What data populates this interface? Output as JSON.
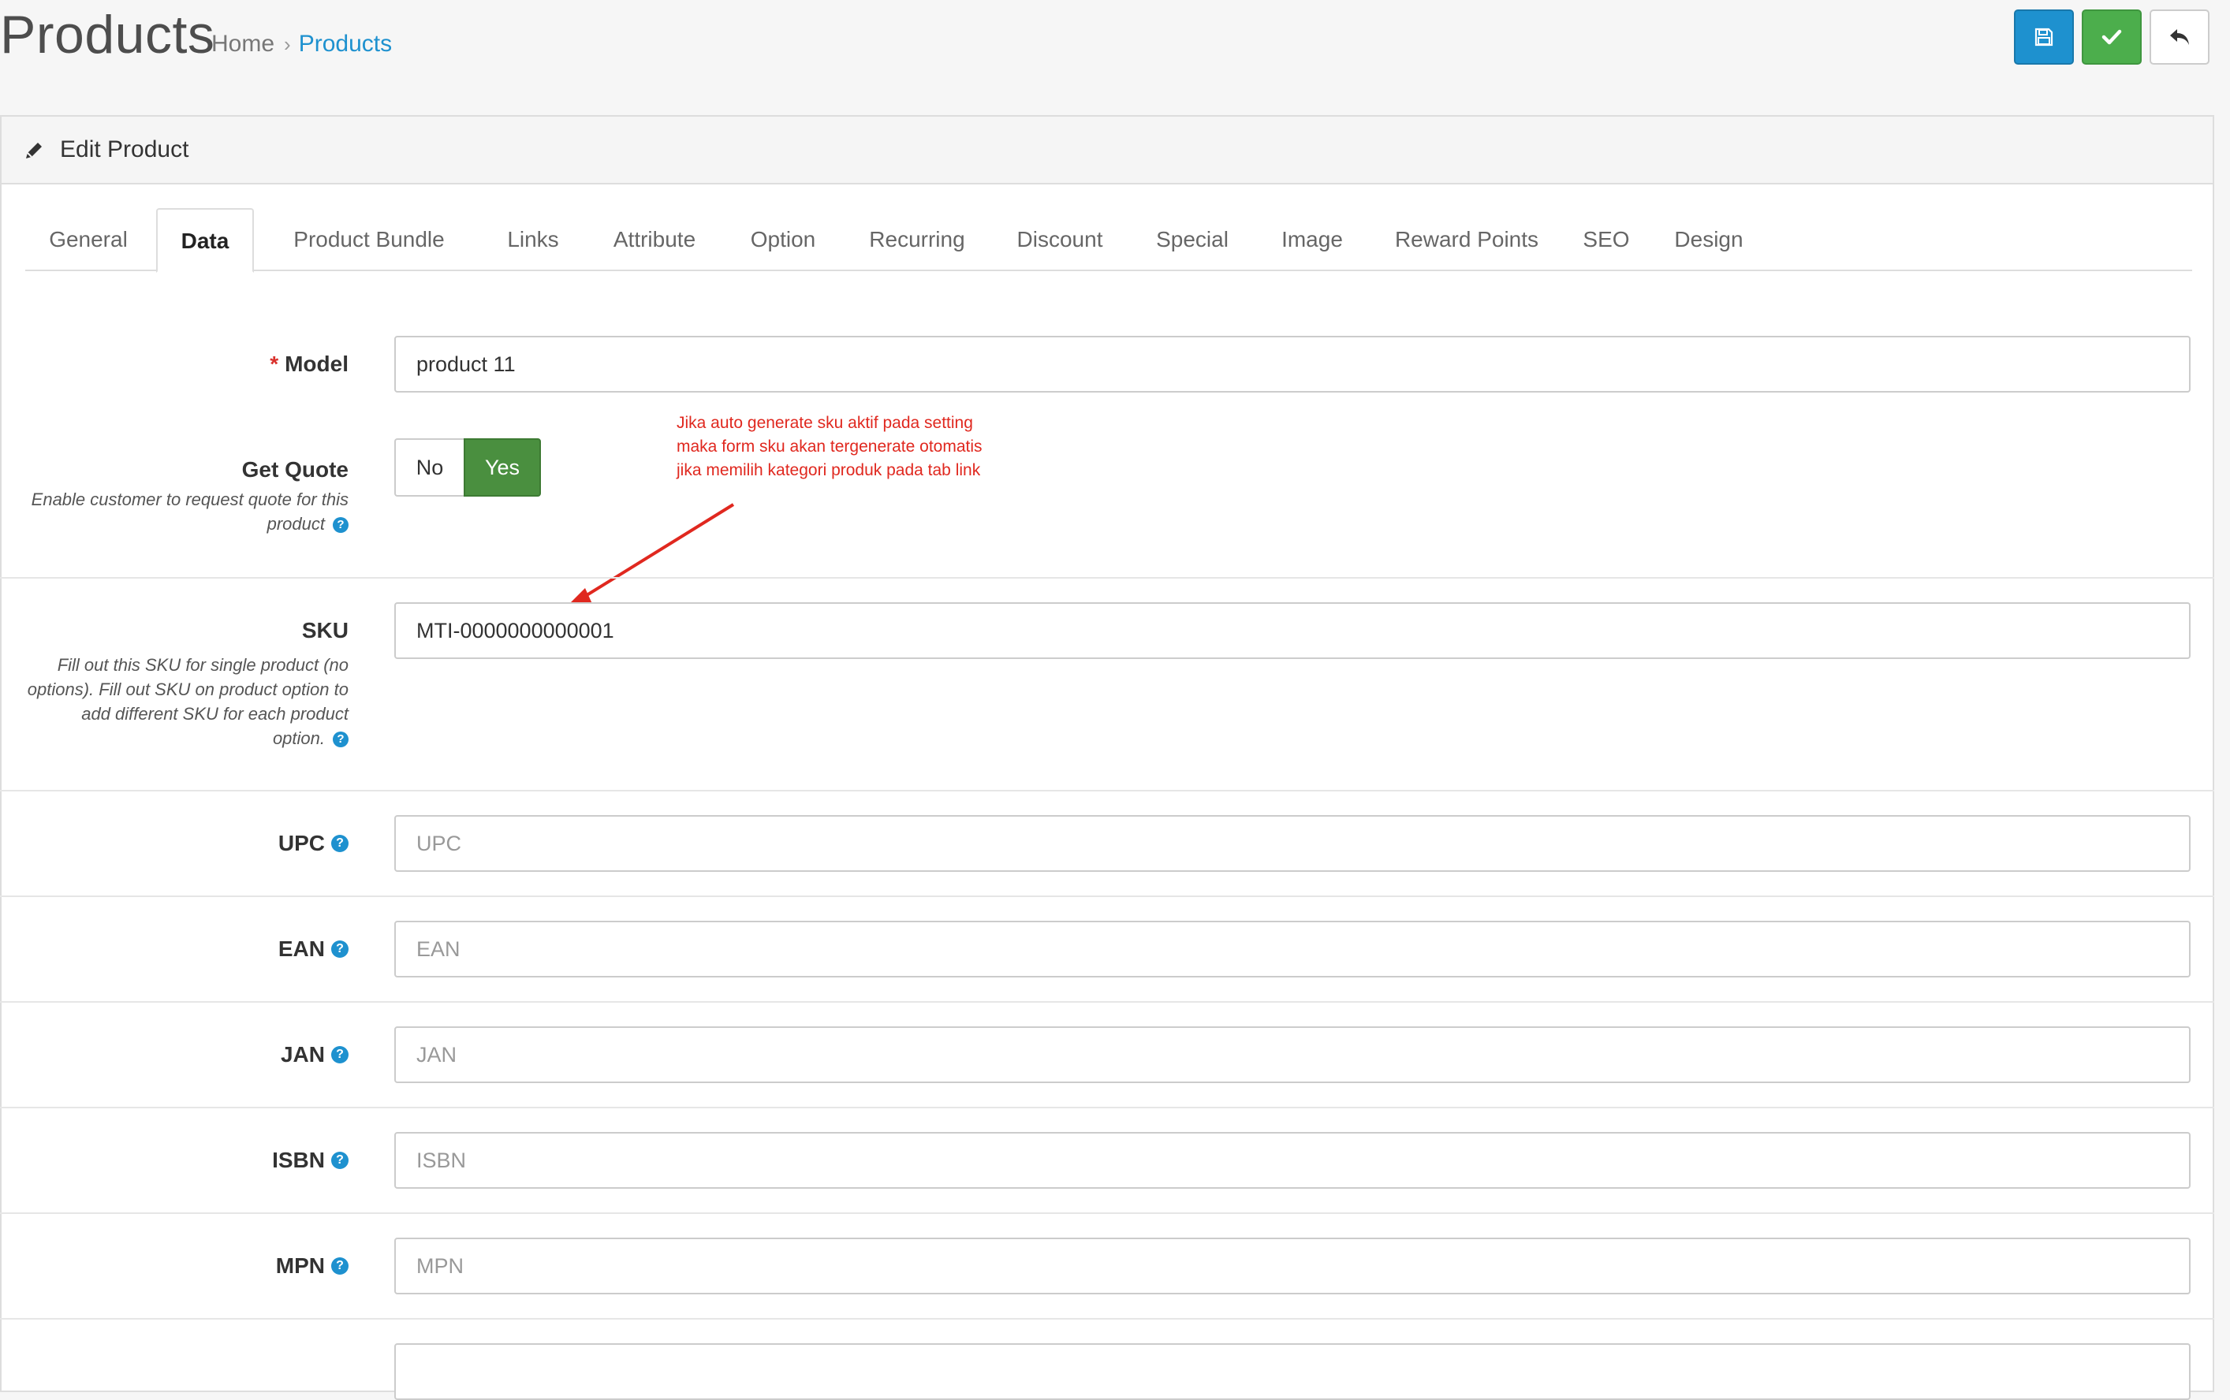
{
  "header": {
    "title": "Products",
    "breadcrumb": {
      "home": "Home",
      "separator": "›",
      "current": "Products"
    },
    "buttons": {
      "save_icon": "floppy-disk-icon",
      "save_color": "#1e91cf",
      "confirm_icon": "check-icon",
      "confirm_color": "#4cae4c",
      "back_icon": "reply-icon"
    }
  },
  "panel": {
    "title": "Edit Product",
    "title_icon": "pencil-icon",
    "tabs": [
      {
        "label": "General"
      },
      {
        "label": "Data",
        "active": true
      },
      {
        "label": "Product Bundle"
      },
      {
        "label": "Links"
      },
      {
        "label": "Attribute"
      },
      {
        "label": "Option"
      },
      {
        "label": "Recurring"
      },
      {
        "label": "Discount"
      },
      {
        "label": "Special"
      },
      {
        "label": "Image"
      },
      {
        "label": "Reward Points"
      },
      {
        "label": "SEO"
      },
      {
        "label": "Design"
      }
    ]
  },
  "form": {
    "model": {
      "required_mark": "*",
      "label": "Model",
      "value": "product 11"
    },
    "get_quote": {
      "label": "Get Quote",
      "help": [
        "Enable customer to request quote for this",
        "product"
      ],
      "options": [
        "No",
        "Yes"
      ],
      "selected": "Yes",
      "selected_color": "#4a8f3f"
    },
    "annotation": {
      "lines": [
        "Jika auto generate sku aktif pada setting",
        "maka form sku akan tergenerate otomatis",
        "jika memilih kategori produk pada tab link"
      ],
      "color": "#e0281f"
    },
    "sku": {
      "label": "SKU",
      "value": "MTI-0000000000001",
      "help": [
        "Fill out this SKU for single product (no",
        "options). Fill out SKU on product option to",
        "add different SKU for each product",
        "option."
      ]
    },
    "upc": {
      "label": "UPC",
      "placeholder": "UPC"
    },
    "ean": {
      "label": "EAN",
      "placeholder": "EAN"
    },
    "jan": {
      "label": "JAN",
      "placeholder": "JAN"
    },
    "isbn": {
      "label": "ISBN",
      "placeholder": "ISBN"
    },
    "mpn": {
      "label": "MPN",
      "placeholder": "MPN"
    },
    "help_icon": "question-circle-icon",
    "help_glyph": "?"
  }
}
